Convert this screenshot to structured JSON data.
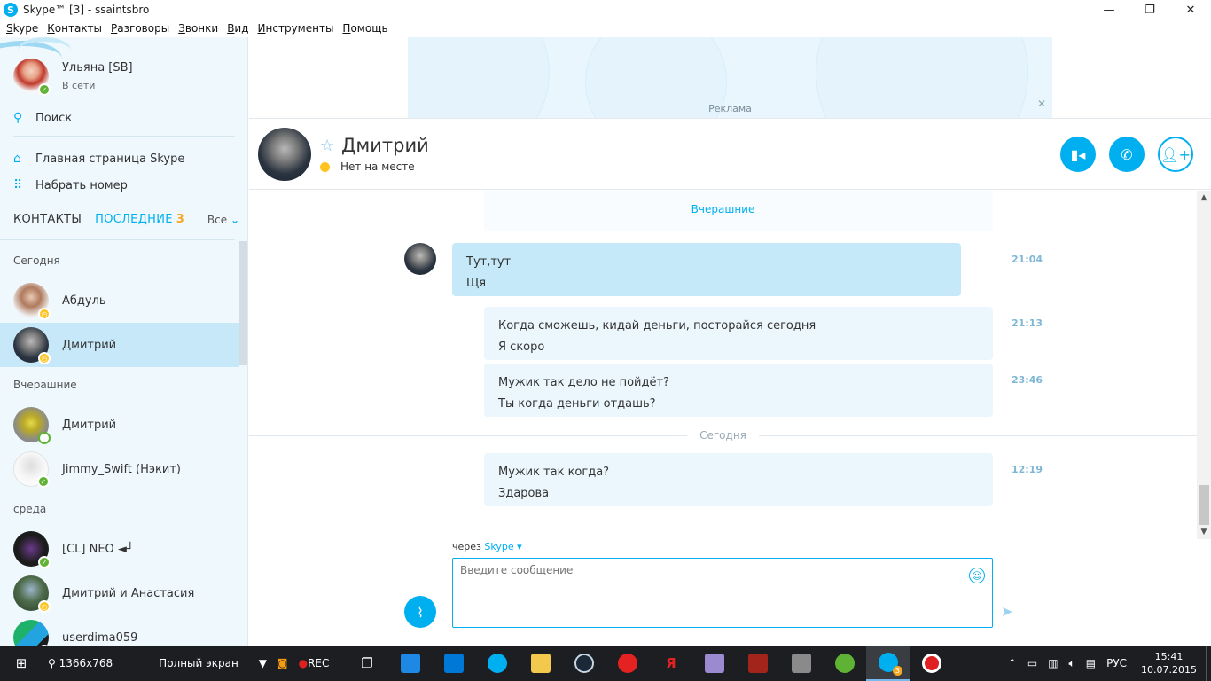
{
  "window": {
    "title": "Skype™ [3] - ssaintsbro",
    "minimize": "—",
    "restore": "❐",
    "close": "✕"
  },
  "menu": [
    "Skype",
    "Контакты",
    "Разговоры",
    "Звонки",
    "Вид",
    "Инструменты",
    "Помощь"
  ],
  "me": {
    "name": "Ульяна [SB]",
    "status": "В сети",
    "avatar_color": "#f4e2d8"
  },
  "sidebar": {
    "search": "Поиск",
    "home": "Главная страница Skype",
    "dial": "Набрать номер",
    "tabs": {
      "contacts": "КОНТАКТЫ",
      "recent": "ПОСЛЕДНИЕ",
      "recent_count": "3",
      "filter": "Все"
    },
    "sections": {
      "today": "Сегодня",
      "yesterday": "Вчерашние",
      "wednesday": "среда"
    },
    "contacts": [
      {
        "name": "Абдуль",
        "status": "away"
      },
      {
        "name": "Дмитрий",
        "status": "away",
        "selected": true
      },
      {
        "name": "Дмитрий",
        "status": "offline"
      },
      {
        "name": "Jimmy_Swift (Нэкит)",
        "status": "online"
      },
      {
        "name": "[CL] NEO ◄┘",
        "status": "online"
      },
      {
        "name": "Дмитрий и Анастасия",
        "status": "away"
      },
      {
        "name": "userdima059",
        "status": "online"
      }
    ]
  },
  "ad": {
    "label": "Реклама",
    "close": "✕"
  },
  "chat": {
    "name": "Дмитрий",
    "status": "Нет на месте",
    "buttons": {
      "video": "video-icon",
      "call": "phone-icon",
      "add": "add-contact-icon"
    },
    "yesterday_label": "Вчерашние",
    "today_label": "Сегодня",
    "messages": [
      {
        "from": "them",
        "lines": [
          "Тут,тут",
          "Щя"
        ],
        "time": "21:04"
      },
      {
        "from": "me",
        "lines": [
          "Когда сможешь, кидай деньги, посторайся сегодня",
          "Я скоро"
        ],
        "time": "21:13"
      },
      {
        "from": "me",
        "lines": [
          "Мужик так дело не пойдёт?",
          "Ты когда деньги отдашь?"
        ],
        "time": "23:46"
      },
      {
        "from": "me",
        "lines": [
          "Мужик так когда?",
          "Здарова"
        ],
        "time": "12:19"
      }
    ]
  },
  "compose": {
    "via_prefix": "через",
    "via": "Skype",
    "placeholder": "Введите сообщение"
  },
  "taskbar": {
    "resolution": "1366x768",
    "fullscreen": "Полный экран",
    "rec": "REC",
    "language": "РУС",
    "time": "15:41",
    "date": "10.07.2015",
    "skype_badge": "3"
  },
  "colors": {
    "accent": "#00aff0",
    "away": "#ffc31d",
    "online": "#5fb233"
  }
}
